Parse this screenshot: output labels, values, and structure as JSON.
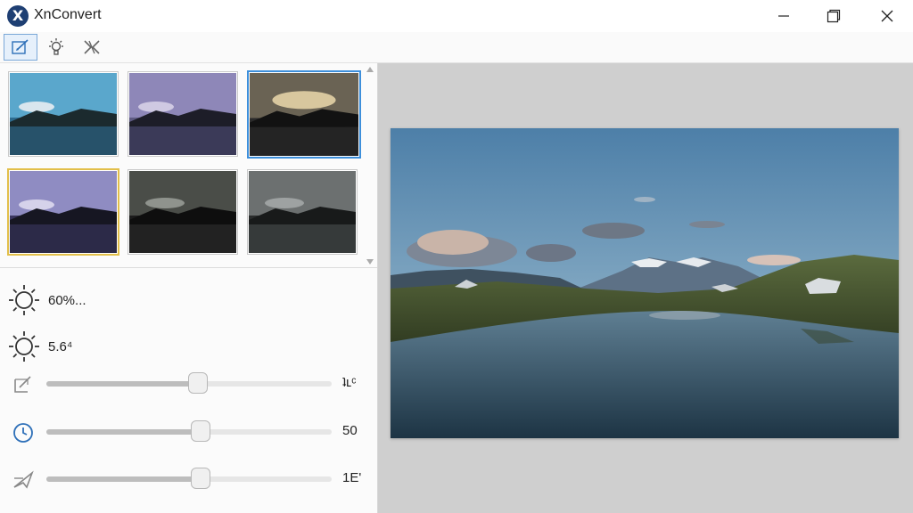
{
  "window": {
    "title": "XnConvert",
    "logo_letter": "X"
  },
  "toolbar": {
    "tools": [
      {
        "name": "edit-tool",
        "active": true
      },
      {
        "name": "brightness-tool",
        "active": false
      },
      {
        "name": "crop-tool",
        "active": false
      }
    ]
  },
  "adjustments": {
    "brightness_1": "60%...",
    "brightness_2": "5.6⁴"
  },
  "sliders": [
    {
      "icon": "crop-corner-icon",
      "value_label": "ʇʟᶜ",
      "level": 0.53
    },
    {
      "icon": "clock-icon",
      "value_label": "50",
      "level": 0.54
    },
    {
      "icon": "plane-icon",
      "value_label": "1E'",
      "level": 0.54
    }
  ],
  "colors": {
    "accent": "#3d8fdb",
    "gold_selection": "#e2bf4a",
    "preview_background": "#cfcfcf"
  }
}
